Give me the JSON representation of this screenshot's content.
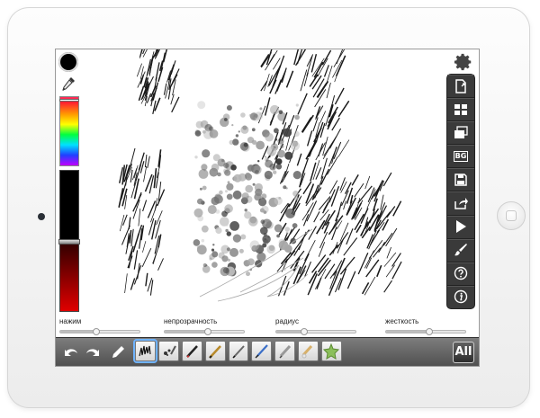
{
  "colors": {
    "current": "#000000",
    "toolbar": "#3a3a3a",
    "selected_brush": "#6fb3ff"
  },
  "palette": {
    "hue_marker_pct": 2,
    "shade_handle_pct": 50
  },
  "toolbar_icons": [
    "new-page-icon",
    "layers-icon",
    "gallery-icon",
    "background-icon",
    "save-icon",
    "share-icon",
    "play-icon",
    "brush-settings-icon",
    "help-icon",
    "info-icon"
  ],
  "toolbar": {
    "background_label": "BG"
  },
  "sliders": [
    {
      "label": "нажим",
      "value_pct": 45
    },
    {
      "label": "непрозрачность",
      "value_pct": 55
    },
    {
      "label": "радиус",
      "value_pct": 35
    },
    {
      "label": "жесткость",
      "value_pct": 55
    }
  ],
  "bottom": {
    "all_label": "All",
    "brush_count": 8,
    "selected_brush_index": 0
  }
}
